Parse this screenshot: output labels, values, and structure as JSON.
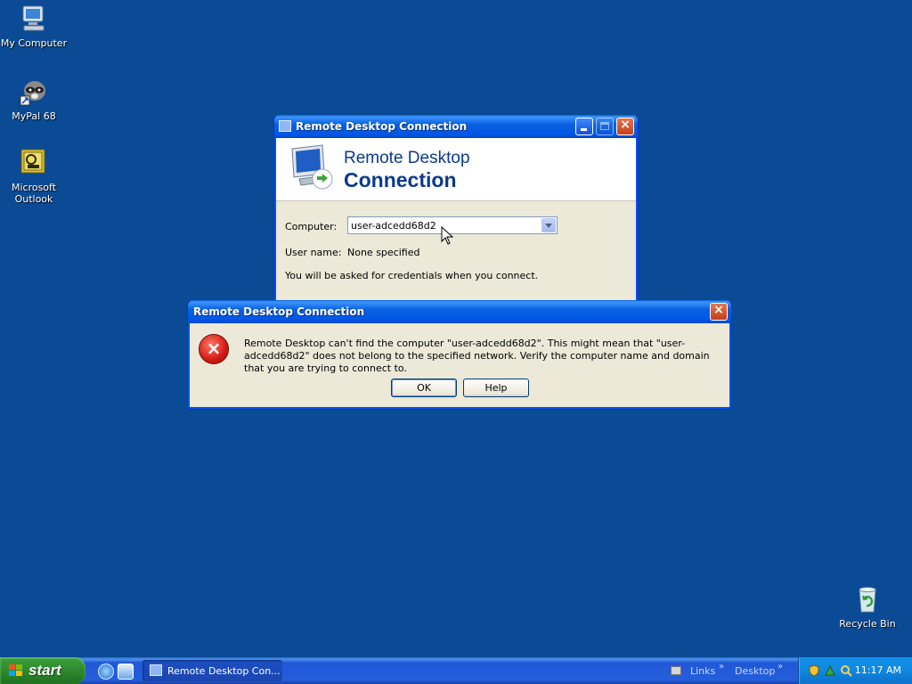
{
  "desktop": {
    "icons": [
      {
        "label": "My Computer"
      },
      {
        "label": "MyPal 68"
      },
      {
        "label": "Microsoft Outlook"
      },
      {
        "label": "Recycle Bin"
      }
    ]
  },
  "rdc_window": {
    "title": "Remote Desktop Connection",
    "banner_line1": "Remote Desktop",
    "banner_line2": "Connection",
    "computer_label": "Computer:",
    "computer_value": "user-adcedd68d2",
    "username_label": "User name:",
    "username_value": "None specified",
    "credentials_note": "You will be asked for credentials when you connect."
  },
  "error_dialog": {
    "title": "Remote Desktop Connection",
    "message": "Remote Desktop can't find the computer \"user-adcedd68d2\". This might mean that \"user-adcedd68d2\" does not belong to the specified network.  Verify the computer name and domain that you are trying to connect to.",
    "ok_label": "OK",
    "help_label": "Help"
  },
  "taskbar": {
    "start_label": "start",
    "task_button_label": "Remote Desktop Con...",
    "links_label": "Links",
    "desktop_label": "Desktop",
    "clock": "11:17 AM"
  },
  "colors": {
    "desktop_bg": "#0b4a94",
    "title_blue": "#0055e5",
    "close_red": "#c3401a",
    "error_red": "#d21a14"
  }
}
